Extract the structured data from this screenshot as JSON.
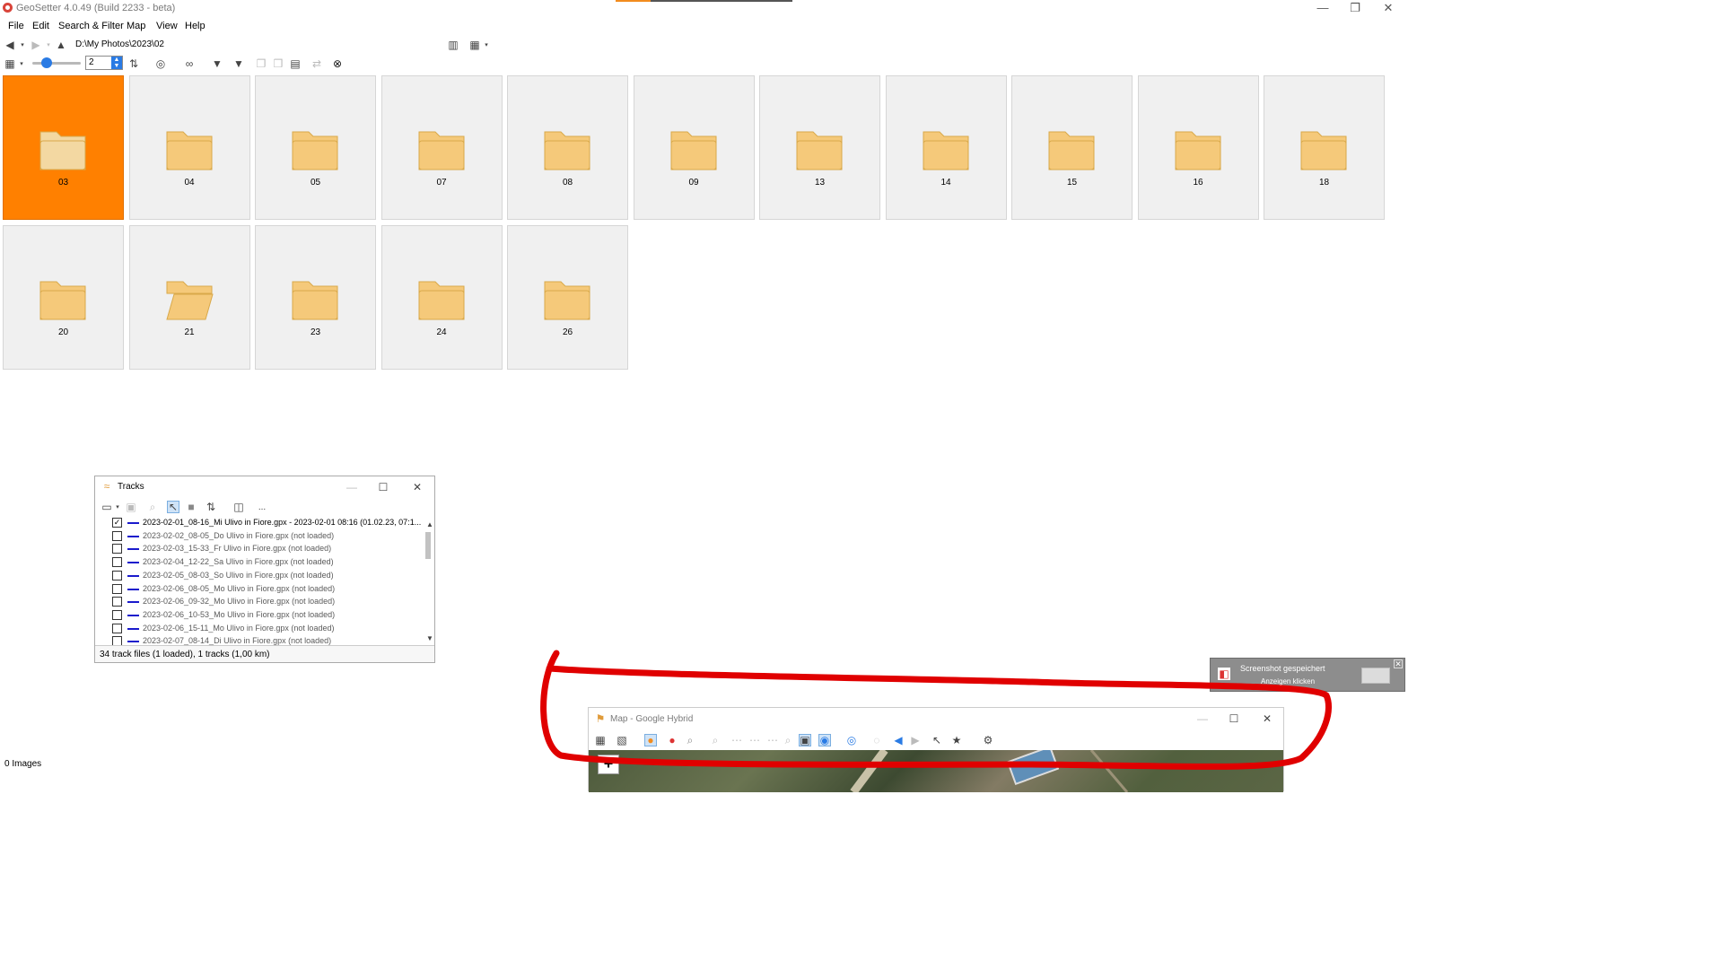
{
  "window": {
    "title": "GeoSetter 4.0.49 (Build 2233 - beta)",
    "minimize": "—",
    "restore": "❐",
    "close": "✕"
  },
  "top_progress": {
    "fraction": 0.2
  },
  "menu": [
    "File",
    "Edit",
    "Search & Filter",
    "Map",
    "View",
    "Help"
  ],
  "address": {
    "path": "D:\\My Photos\\2023\\02"
  },
  "zoom_spin": {
    "value": "2",
    "slider_fraction": 0.3
  },
  "folders": [
    {
      "label": "03",
      "selected": true
    },
    {
      "label": "04"
    },
    {
      "label": "05"
    },
    {
      "label": "07"
    },
    {
      "label": "08"
    },
    {
      "label": "09"
    },
    {
      "label": "13"
    },
    {
      "label": "14"
    },
    {
      "label": "15"
    },
    {
      "label": "16"
    },
    {
      "label": "18"
    },
    {
      "label": "20"
    },
    {
      "label": "21",
      "open": true
    },
    {
      "label": "23"
    },
    {
      "label": "24"
    },
    {
      "label": "26"
    }
  ],
  "tracks_panel": {
    "title": "Tracks",
    "status": "34 track files (1 loaded), 1 tracks (1,00 km)",
    "more_label": "...",
    "items": [
      {
        "text": "2023-02-01_08-16_Mi Ulivo in Fiore.gpx - 2023-02-01 08:16 (01.02.23, 07:1...",
        "checked": true,
        "loaded": true
      },
      {
        "text": "2023-02-02_08-05_Do Ulivo in Fiore.gpx (not loaded)",
        "checked": false
      },
      {
        "text": "2023-02-03_15-33_Fr Ulivo in Fiore.gpx (not loaded)",
        "checked": false
      },
      {
        "text": "2023-02-04_12-22_Sa Ulivo in Fiore.gpx (not loaded)",
        "checked": false
      },
      {
        "text": "2023-02-05_08-03_So Ulivo in Fiore.gpx (not loaded)",
        "checked": false
      },
      {
        "text": "2023-02-06_08-05_Mo Ulivo in Fiore.gpx (not loaded)",
        "checked": false
      },
      {
        "text": "2023-02-06_09-32_Mo Ulivo in Fiore.gpx (not loaded)",
        "checked": false
      },
      {
        "text": "2023-02-06_10-53_Mo Ulivo in Fiore.gpx (not loaded)",
        "checked": false
      },
      {
        "text": "2023-02-06_15-11_Mo Ulivo in Fiore.gpx (not loaded)",
        "checked": false
      },
      {
        "text": "2023-02-07_08-14_Di Ulivo in Fiore.gpx (not loaded)",
        "checked": false
      }
    ]
  },
  "map_panel": {
    "title": "Map - Google Hybrid",
    "zoom_in": "+"
  },
  "statusbar": {
    "text": "0 Images"
  },
  "toast": {
    "title": "Screenshot gespeichert",
    "subtitle": "Anzeigen klicken"
  },
  "colors": {
    "accent": "#ff8000",
    "folder": "#f5c97a",
    "track_line": "#1a1acc",
    "annotation": "#e00000"
  }
}
